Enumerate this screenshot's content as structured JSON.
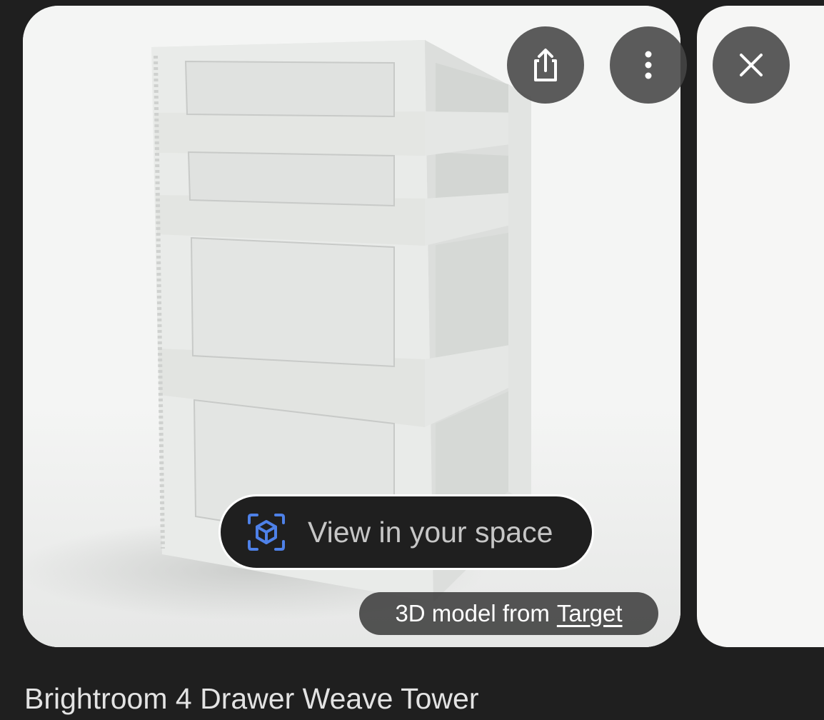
{
  "viewer": {
    "share_button_icon": "share-icon",
    "more_button_icon": "more-vert-icon",
    "close_button_icon": "close-icon",
    "ar_button": {
      "label": "View in your space",
      "icon": "view-in-ar-icon",
      "icon_color": "#4e81e8"
    },
    "source": {
      "prefix": "3D model from",
      "link_label": "Target"
    }
  },
  "product": {
    "title": "Brightroom 4 Drawer Weave Tower"
  }
}
